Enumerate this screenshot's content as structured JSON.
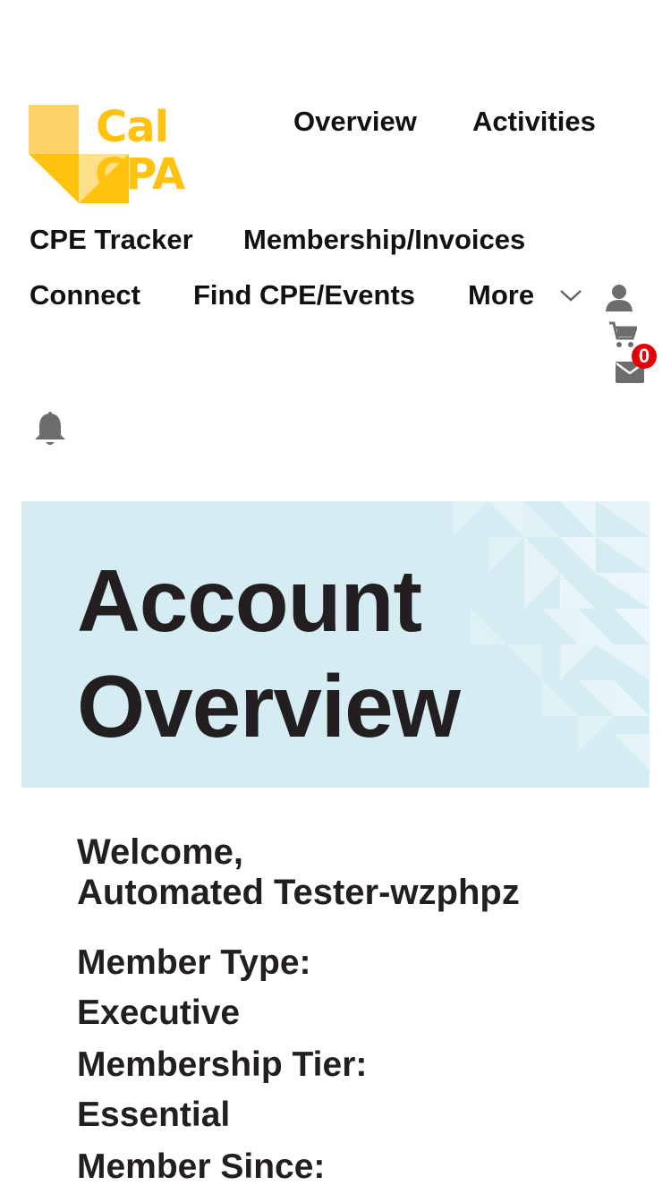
{
  "brand": {
    "line1": "Cal",
    "line2": "CPA",
    "color": "#ffc20e"
  },
  "nav": {
    "overview": "Overview",
    "activities": "Activities",
    "cpe_tracker": "CPE Tracker",
    "membership": "Membership/Invoices",
    "connect": "Connect",
    "find_cpe": "Find CPE/Events",
    "more": "More"
  },
  "icons": {
    "user": "user-icon",
    "cart": "cart-icon",
    "mail": "mail-icon",
    "bell": "bell-icon",
    "chevron": "chevron-down-icon"
  },
  "mail_count": "0",
  "hero": {
    "line1": "Account",
    "line2": "Overview",
    "bg": "#d5edf2"
  },
  "welcome": {
    "greeting": "Welcome,",
    "name": "Automated Tester-wzphpz"
  },
  "details": {
    "member_type_label": "Member Type:",
    "member_type_value": "Executive",
    "tier_label": "Membership Tier:",
    "tier_value": "Essential",
    "since_label": "Member Since:"
  }
}
